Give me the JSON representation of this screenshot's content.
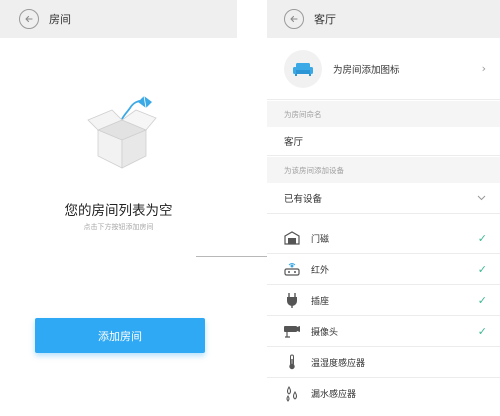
{
  "left_screen": {
    "title": "房间",
    "empty_title": "您的房间列表为空",
    "empty_hint": "点击下方按钮添加房间",
    "add_button": "添加房间"
  },
  "right_screen": {
    "title": "客厅",
    "add_icon_label": "为房间添加图标",
    "name_section_label": "为房间命名",
    "room_name": "客厅",
    "devices_section_label": "为该房间添加设备",
    "existing_label": "已有设备",
    "devices": [
      {
        "label": "门磁",
        "icon": "door-sensor-icon",
        "checked": true
      },
      {
        "label": "红外",
        "icon": "infrared-icon",
        "checked": true
      },
      {
        "label": "插座",
        "icon": "socket-icon",
        "checked": true
      },
      {
        "label": "摄像头",
        "icon": "camera-icon",
        "checked": true
      },
      {
        "label": "温湿度感应器",
        "icon": "thermometer-icon",
        "checked": false
      },
      {
        "label": "漏水感应器",
        "icon": "water-leak-icon",
        "checked": false
      }
    ]
  },
  "colors": {
    "accent": "#30a9f5",
    "check": "#3fb894",
    "topbar": "#efefef"
  }
}
